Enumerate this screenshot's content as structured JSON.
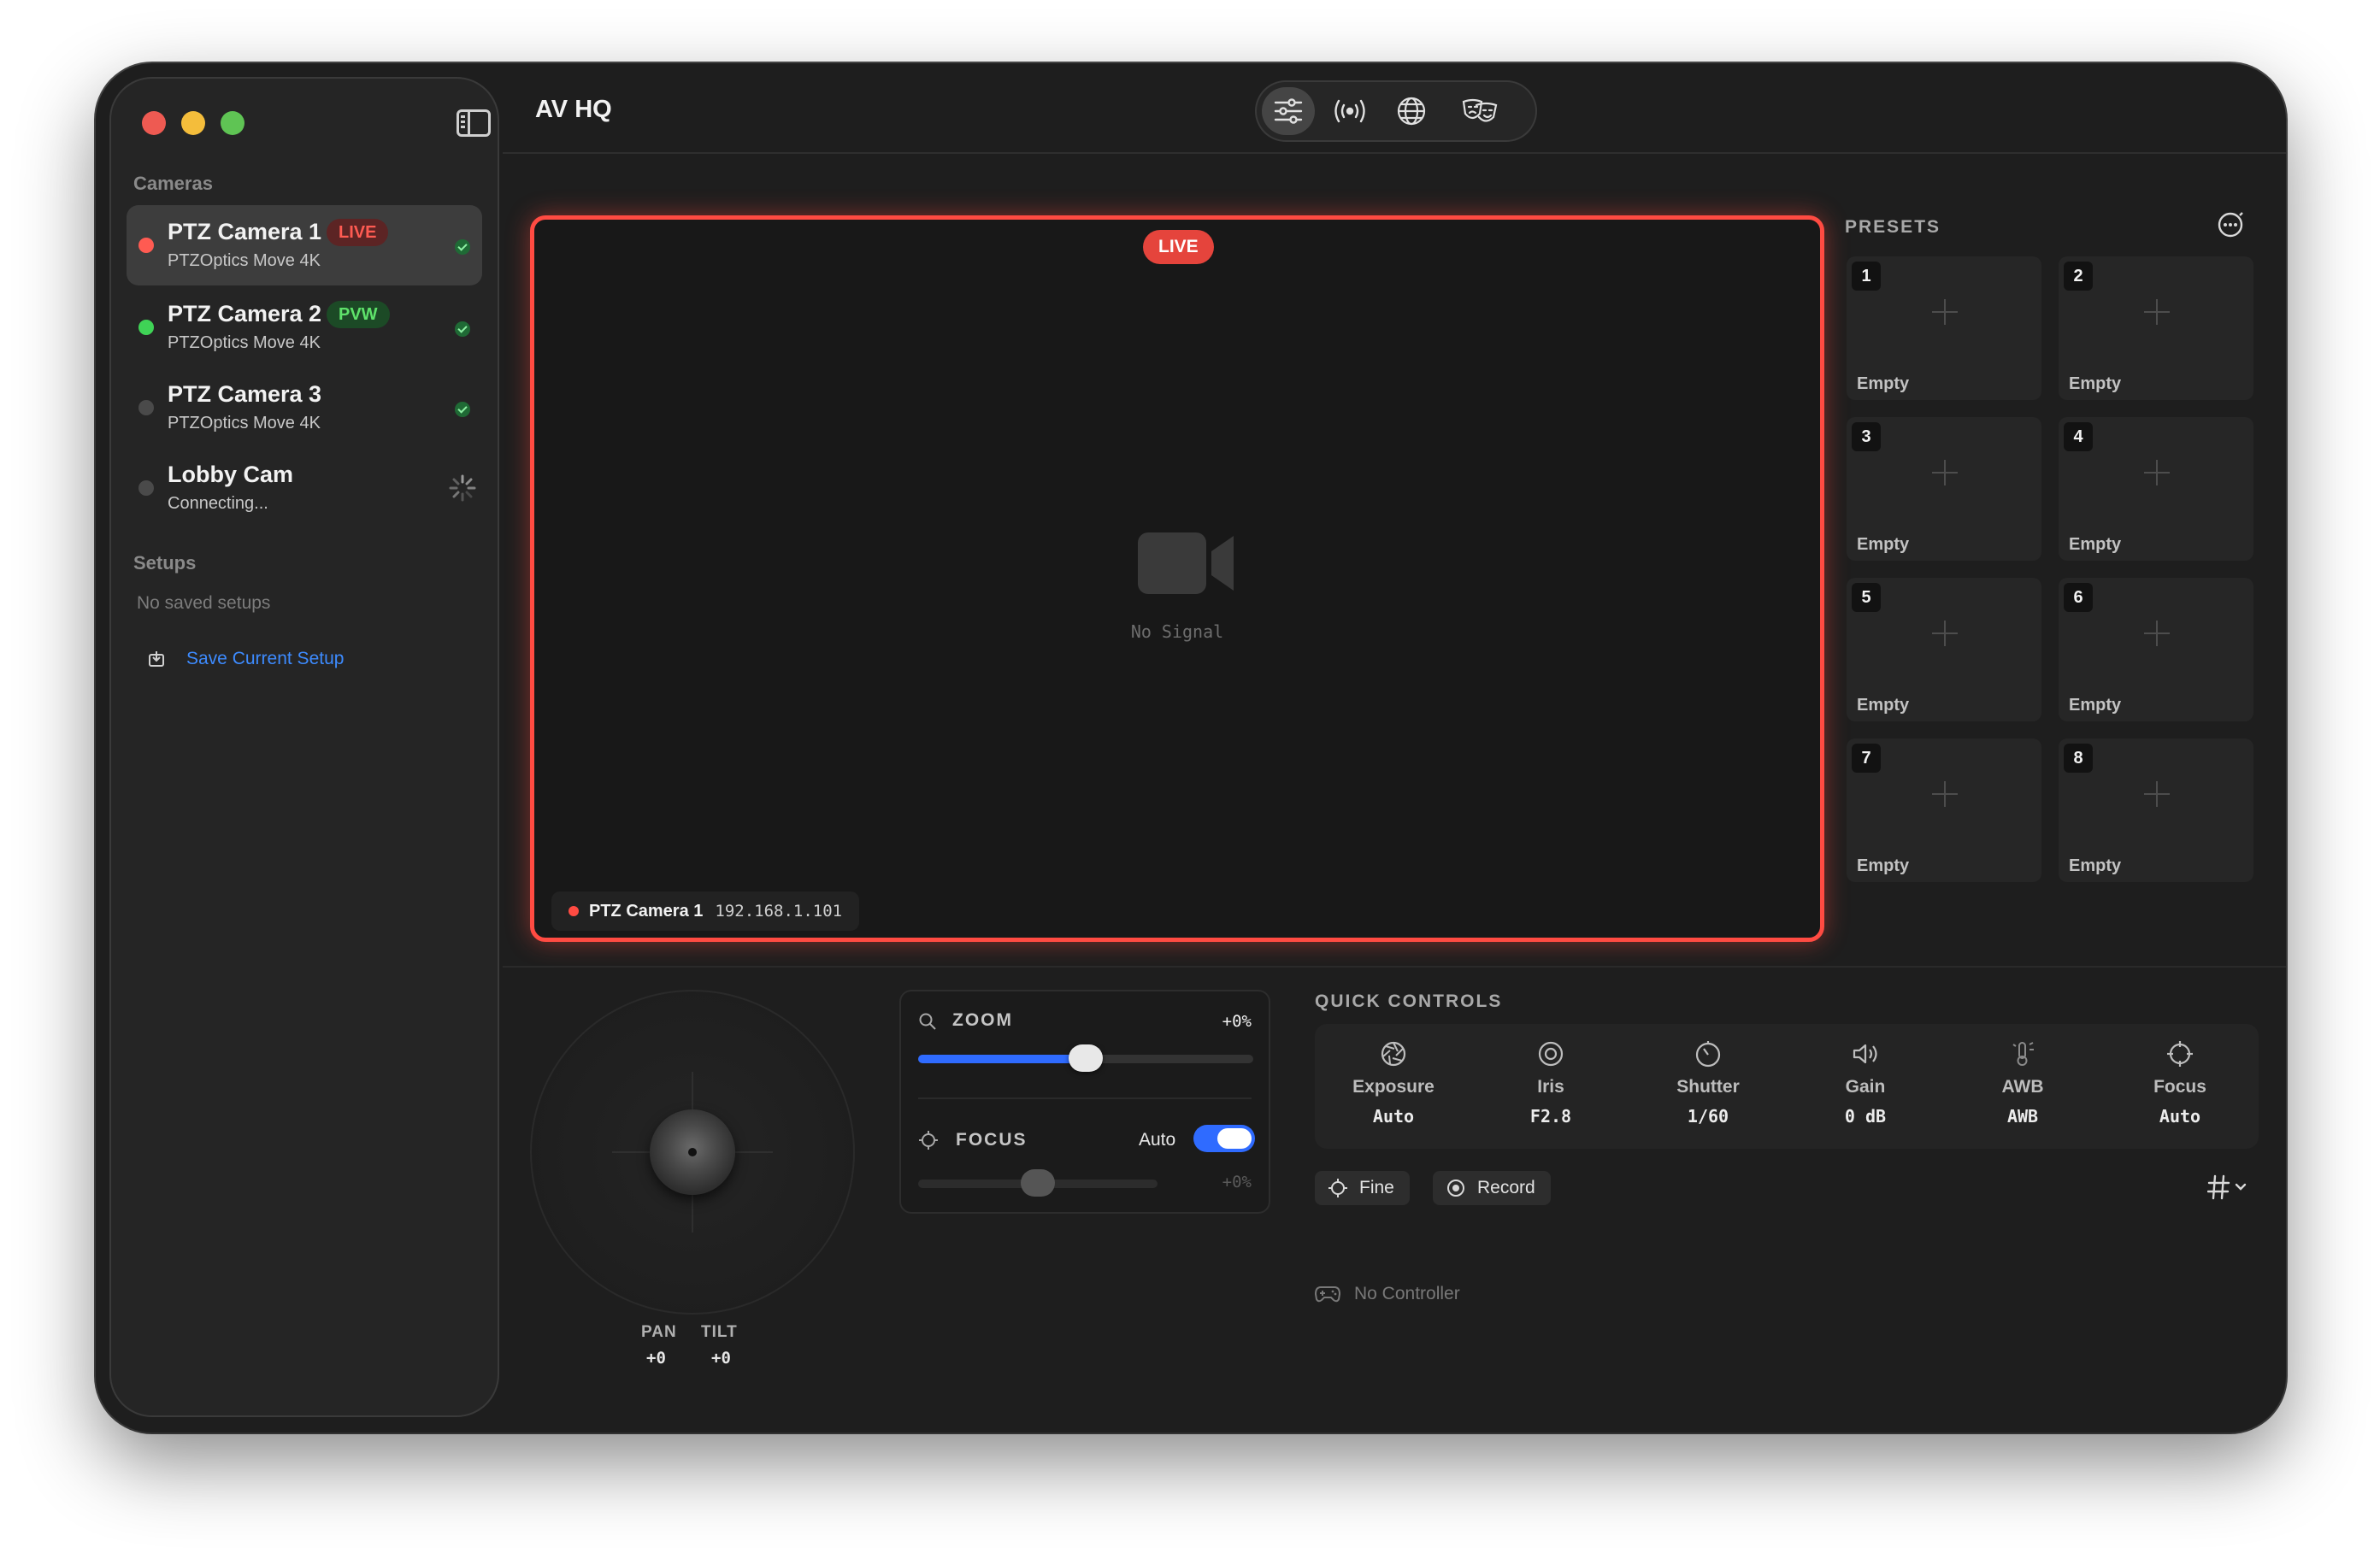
{
  "app": {
    "title": "AV HQ"
  },
  "sidebar": {
    "cameras_heading": "Cameras",
    "cameras": [
      {
        "name": "PTZ Camera 1",
        "model": "PTZOptics Move 4K",
        "badge": "LIVE",
        "status_color": "#ff5b52"
      },
      {
        "name": "PTZ Camera 2",
        "model": "PTZOptics Move 4K",
        "badge": "PVW",
        "status_color": "#3fd356"
      },
      {
        "name": "PTZ Camera 3",
        "model": "PTZOptics Move 4K",
        "badge": "",
        "status_color": "#4a4a4a"
      },
      {
        "name": "Lobby Cam",
        "model": "Connecting...",
        "badge": "",
        "status_color": "#4a4a4a"
      }
    ],
    "setups_heading": "Setups",
    "no_setups": "No saved setups",
    "save_setup": "Save Current Setup"
  },
  "toolbar": {
    "buttons": [
      "sliders-icon",
      "broadcast-icon",
      "globe-icon",
      "theater-masks-icon"
    ],
    "active": "sliders-icon"
  },
  "viewer": {
    "live_label": "LIVE",
    "no_signal": "No Signal",
    "camera_name": "PTZ Camera 1",
    "camera_ip": "192.168.1.101",
    "border_color": "#ff4b42"
  },
  "presets": {
    "title": "PRESETS",
    "items": [
      {
        "num": "1",
        "label": "Empty"
      },
      {
        "num": "2",
        "label": "Empty"
      },
      {
        "num": "3",
        "label": "Empty"
      },
      {
        "num": "4",
        "label": "Empty"
      },
      {
        "num": "5",
        "label": "Empty"
      },
      {
        "num": "6",
        "label": "Empty"
      },
      {
        "num": "7",
        "label": "Empty"
      },
      {
        "num": "8",
        "label": "Empty"
      }
    ]
  },
  "ptz": {
    "pan_label": "PAN",
    "pan_value": "+0",
    "tilt_label": "TILT",
    "tilt_value": "+0"
  },
  "zoom": {
    "label": "ZOOM",
    "value": "+0%",
    "level": 0.5
  },
  "focus": {
    "label": "FOCUS",
    "auto_label": "Auto",
    "auto_enabled": true,
    "value": "+0%",
    "level": 0.5
  },
  "quick_controls": {
    "title": "QUICK CONTROLS",
    "items": [
      {
        "name": "Exposure",
        "value": "Auto",
        "icon": "aperture-icon"
      },
      {
        "name": "Iris",
        "value": "F2.8",
        "icon": "iris-icon"
      },
      {
        "name": "Shutter",
        "value": "1/60",
        "icon": "shutter-icon"
      },
      {
        "name": "Gain",
        "value": "0 dB",
        "icon": "speaker-icon"
      },
      {
        "name": "AWB",
        "value": "AWB",
        "icon": "thermometer-icon"
      },
      {
        "name": "Focus",
        "value": "Auto",
        "icon": "crosshair-icon"
      }
    ],
    "fine_label": "Fine",
    "record_label": "Record",
    "no_controller": "No Controller"
  },
  "colors": {
    "accent": "#2f6bff",
    "live": "#ff4b42",
    "preview": "#3fd356",
    "link": "#3d8bff"
  }
}
